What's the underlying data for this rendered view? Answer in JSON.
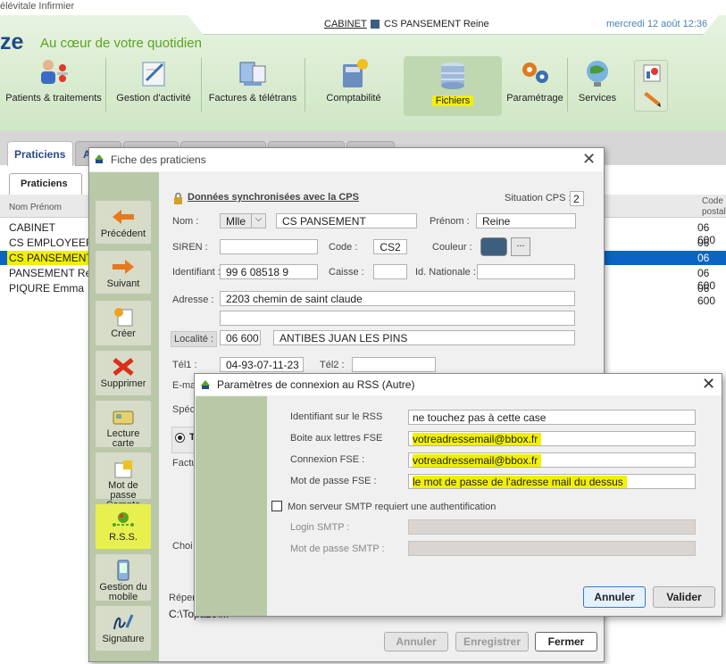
{
  "app": {
    "window_title": "élévitale Infirmier",
    "logo": "ze",
    "slogan": "Au cœur de votre quotidien",
    "cabinet_link": "CABINET",
    "current_practitioner": "CS PANSEMENT Reine",
    "date": "mercredi 12 août 12:36"
  },
  "nav": [
    {
      "label": "Patients & traitements",
      "icon": "patients-icon"
    },
    {
      "label": "Gestion d'activité",
      "icon": "activity-icon"
    },
    {
      "label": "Factures & télétrans",
      "icon": "invoices-icon"
    },
    {
      "label": "Comptabilité",
      "icon": "accounting-icon"
    },
    {
      "label": "Fichiers",
      "icon": "files-icon",
      "active": true
    },
    {
      "label": "Paramétrage",
      "icon": "settings-icon"
    },
    {
      "label": "Services",
      "icon": "services-icon"
    }
  ],
  "main": {
    "tab_label": "Praticiens",
    "tab2_initial": "A",
    "subtab_label": "Praticiens",
    "col_name": "Nom Prénom",
    "col_code_line1": "Code",
    "col_code_line2": "postal",
    "rows": [
      {
        "name": "CABINET",
        "cp": "06 600"
      },
      {
        "name": "CS EMPLOYEEF",
        "cp": "06 600"
      },
      {
        "name": "CS PANSEMENT",
        "cp": "06 600",
        "selected": true
      },
      {
        "name": "PANSEMENT Re",
        "cp": "06 600"
      },
      {
        "name": "PIQURE Emma",
        "cp": "06 600"
      }
    ]
  },
  "fiche": {
    "title": "Fiche des praticiens",
    "sidebar": [
      {
        "label": "Précédent",
        "icon": "arrow-left-icon"
      },
      {
        "label": "Suivant",
        "icon": "arrow-right-icon"
      },
      {
        "label": "Créer",
        "icon": "create-icon"
      },
      {
        "label": "Supprimer",
        "icon": "delete-icon"
      },
      {
        "label": "Lecture carte",
        "icon": "card-reader-icon"
      },
      {
        "label": "Mot de passe Compta",
        "icon": "password-icon"
      },
      {
        "label": "R.S.S.",
        "icon": "rss-icon",
        "highlighted": true
      },
      {
        "label": "Gestion du mobile",
        "icon": "mobile-icon"
      },
      {
        "label": "Signature",
        "icon": "signature-icon"
      }
    ],
    "sync_label": "Données synchronisées avec la CPS",
    "situation_label": "Situation CPS :",
    "situation_value": "2",
    "nom_label": "Nom :",
    "civility": "Mlle",
    "nom_value": "CS PANSEMENT",
    "prenom_label": "Prénom :",
    "prenom_value": "Reine",
    "siren_label": "SIREN :",
    "siren_value": "",
    "code_label": "Code :",
    "code_value": "CS2",
    "couleur_label": "Couleur :",
    "couleur_value": "#3d5f7f",
    "ident_label": "Identifiant :",
    "ident_value": "99 6 08518 9",
    "caisse_label": "Caisse :",
    "caisse_value": "",
    "idnat_label": "Id. Nationale :",
    "idnat_value": "",
    "adresse_label": "Adresse :",
    "adresse_value": "2203 chemin de saint claude",
    "adresse2_value": "",
    "localite_label": "Localité :",
    "cp_value": "06 600",
    "ville_value": "ANTIBES JUAN LES PINS",
    "tel1_label": "Tél1 :",
    "tel1_value": "04-93-07-11-23",
    "tel2_label": "Tél2 :",
    "tel2_value": "",
    "email_partial": "E-ma",
    "spec_partial": "Spéc",
    "radio_partial": "T",
    "factu_partial": "Factu",
    "choix_partial": "Choi",
    "repert_partial": "Réper",
    "path_partial": "C:\\Topaze\\...",
    "btn_annuler": "Annuler",
    "btn_enregistrer": "Enregistrer",
    "btn_fermer": "Fermer"
  },
  "rss": {
    "title": "Paramètres de connexion au RSS (Autre)",
    "ident_label": "Identifiant sur le RSS",
    "ident_value": "ne touchez pas à cette case",
    "bal_label": "Boite aux lettres FSE",
    "bal_value": "votreadressemail@bbox.fr",
    "conn_label": "Connexion FSE :",
    "conn_value": "votreadressemail@bbox.fr",
    "pwd_label": "Mot de passe FSE :",
    "pwd_value": "le mot de passe de l'adresse mail du dessus",
    "smtp_check_label": "Mon serveur SMTP requiert une authentification",
    "smtp_login_label": "Login SMTP :",
    "smtp_pwd_label": "Mot de passe SMTP :",
    "btn_annuler": "Annuler",
    "btn_valider": "Valider"
  },
  "colors": {
    "highlight": "#f2f000",
    "selection": "#0a64c6",
    "sidebar": "#b9c9a8"
  }
}
